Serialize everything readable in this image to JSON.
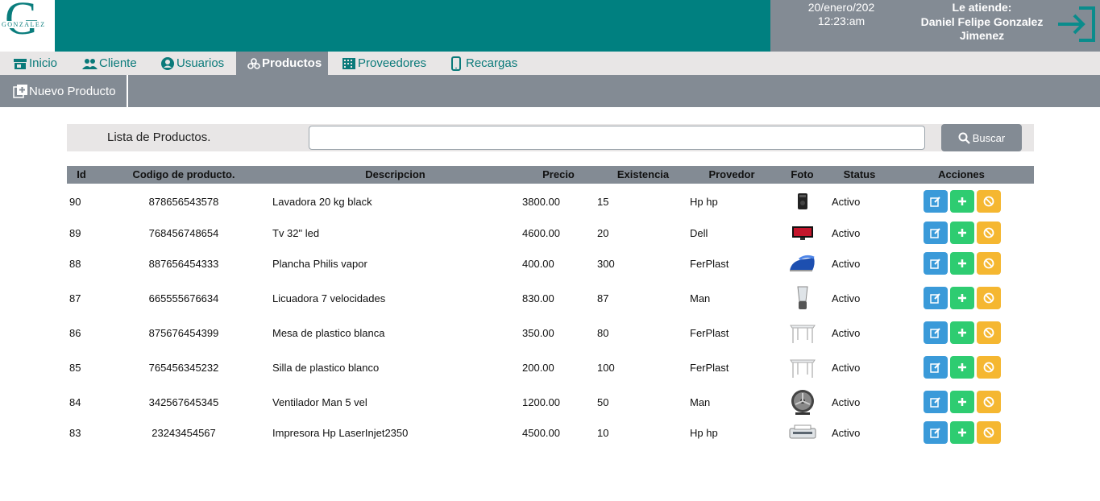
{
  "header": {
    "logo_letter": "G",
    "logo_word": "GONZALEZ",
    "date": "20/enero/202",
    "time": "12:23:am",
    "attends_label": "Le atiende:",
    "user_name_line1": "Daniel Felipe Gonzalez",
    "user_name_line2": "Jimenez",
    "colors": {
      "brand": "#008080",
      "panel": "#838b94"
    }
  },
  "tabs": [
    {
      "label": "Inicio",
      "icon": "store-icon"
    },
    {
      "label": "Cliente",
      "icon": "people-icon"
    },
    {
      "label": "Usuarios",
      "icon": "user-circle-icon"
    },
    {
      "label": "Productos",
      "icon": "boxes-icon",
      "active": true
    },
    {
      "label": "Proveedores",
      "icon": "building-icon"
    },
    {
      "label": "Recargas",
      "icon": "phone-icon"
    }
  ],
  "toolbar": {
    "new_product_label": "Nuevo Producto"
  },
  "search": {
    "title": "Lista de Productos.",
    "value": "",
    "button_label": "Buscar"
  },
  "table": {
    "headers": [
      "Id",
      "Codigo de producto.",
      "Descripcion",
      "Precio",
      "Existencia",
      "Provedor",
      "Foto",
      "Status",
      "Acciones"
    ],
    "rows": [
      {
        "id": "90",
        "code": "878656543578",
        "description": "Lavadora 20 kg black",
        "price": "3800.00",
        "stock": "15",
        "supplier": "Hp hp",
        "photo": "washer-icon",
        "status": "Activo"
      },
      {
        "id": "89",
        "code": "768456748654",
        "description": "Tv 32\" led",
        "price": "4600.00",
        "stock": "20",
        "supplier": "Dell",
        "photo": "tv-icon",
        "status": "Activo"
      },
      {
        "id": "88",
        "code": "887656454333",
        "description": "Plancha Philis vapor",
        "price": "400.00",
        "stock": "300",
        "supplier": "FerPlast",
        "photo": "iron-icon",
        "status": "Activo"
      },
      {
        "id": "87",
        "code": "665555676634",
        "description": "Licuadora 7 velocidades",
        "price": "830.00",
        "stock": "87",
        "supplier": "Man",
        "photo": "blender-icon",
        "status": "Activo"
      },
      {
        "id": "86",
        "code": "875676454399",
        "description": "Mesa de plastico blanca",
        "price": "350.00",
        "stock": "80",
        "supplier": "FerPlast",
        "photo": "table-icon",
        "status": "Activo"
      },
      {
        "id": "85",
        "code": "765456345232",
        "description": "Silla de plastico blanco",
        "price": "200.00",
        "stock": "100",
        "supplier": "FerPlast",
        "photo": "table-icon",
        "status": "Activo"
      },
      {
        "id": "84",
        "code": "342567645345",
        "description": "Ventilador Man 5 vel",
        "price": "1200.00",
        "stock": "50",
        "supplier": "Man",
        "photo": "fan-icon",
        "status": "Activo"
      },
      {
        "id": "83",
        "code": "23243454567",
        "description": "Impresora Hp LaserInjet2350",
        "price": "4500.00",
        "stock": "10",
        "supplier": "Hp hp",
        "photo": "printer-icon",
        "status": "Activo"
      }
    ],
    "action_colors": {
      "edit": "#3a9ad9",
      "add": "#2ecc71",
      "disable": "#f5b731"
    }
  }
}
